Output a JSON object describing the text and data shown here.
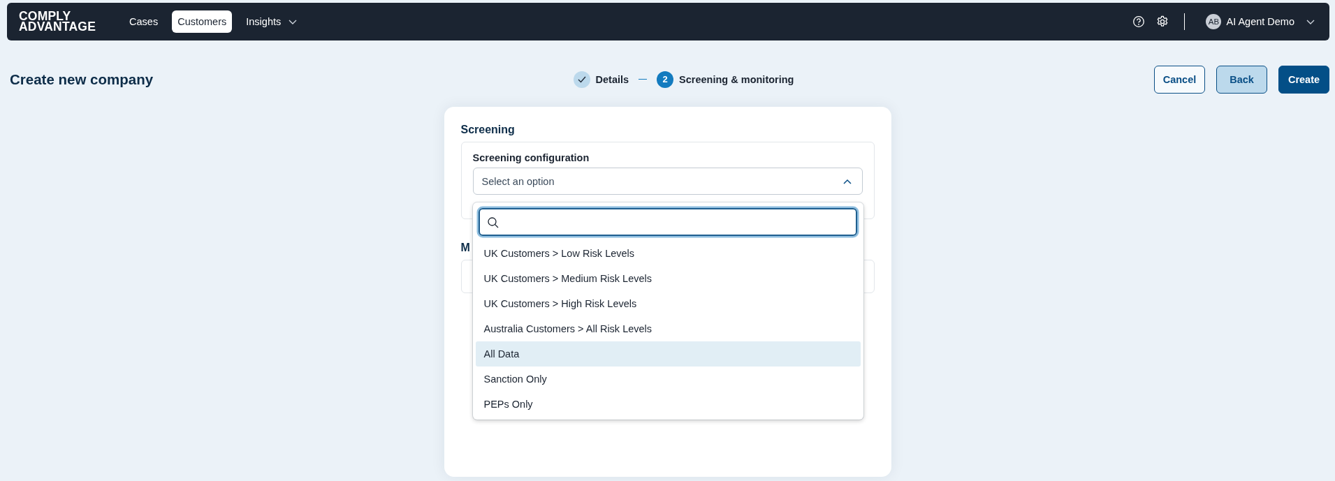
{
  "nav": {
    "logo": [
      "COMPLY",
      "ADVANTAGE"
    ],
    "items": [
      {
        "label": "Cases",
        "selected": false,
        "kind": "link"
      },
      {
        "label": "Customers",
        "selected": true,
        "kind": "link"
      },
      {
        "label": "Insights",
        "selected": false,
        "kind": "menu"
      }
    ],
    "user": {
      "initials": "AB",
      "name": "AI Agent Demo"
    }
  },
  "header": {
    "title": "Create new company",
    "steps": [
      {
        "label": "Details",
        "done": true
      },
      {
        "label": "Screening & monitoring",
        "marker": "2",
        "done": false
      }
    ],
    "buttons": [
      {
        "label": "Cancel",
        "kind": "outline"
      },
      {
        "label": "Back",
        "kind": "soft"
      },
      {
        "label": "Create",
        "kind": "primary"
      }
    ]
  },
  "screening": {
    "heading": "Screening",
    "label": "Screening configuration",
    "placeholder": "Select an option",
    "expanded": true
  },
  "monitoring": {
    "heading": "M"
  },
  "dropdown": {
    "options": [
      {
        "label": "UK Customers > Low Risk Levels",
        "selected": false
      },
      {
        "label": "UK Customers > Medium Risk Levels",
        "selected": false
      },
      {
        "label": "UK Customers > High Risk Levels",
        "selected": false
      },
      {
        "label": "Australia Customers > All Risk Levels",
        "selected": false
      },
      {
        "label": "All Data",
        "selected": true
      },
      {
        "label": "Sanction Only",
        "selected": false
      },
      {
        "label": "PEPs Only",
        "selected": false
      }
    ]
  }
}
